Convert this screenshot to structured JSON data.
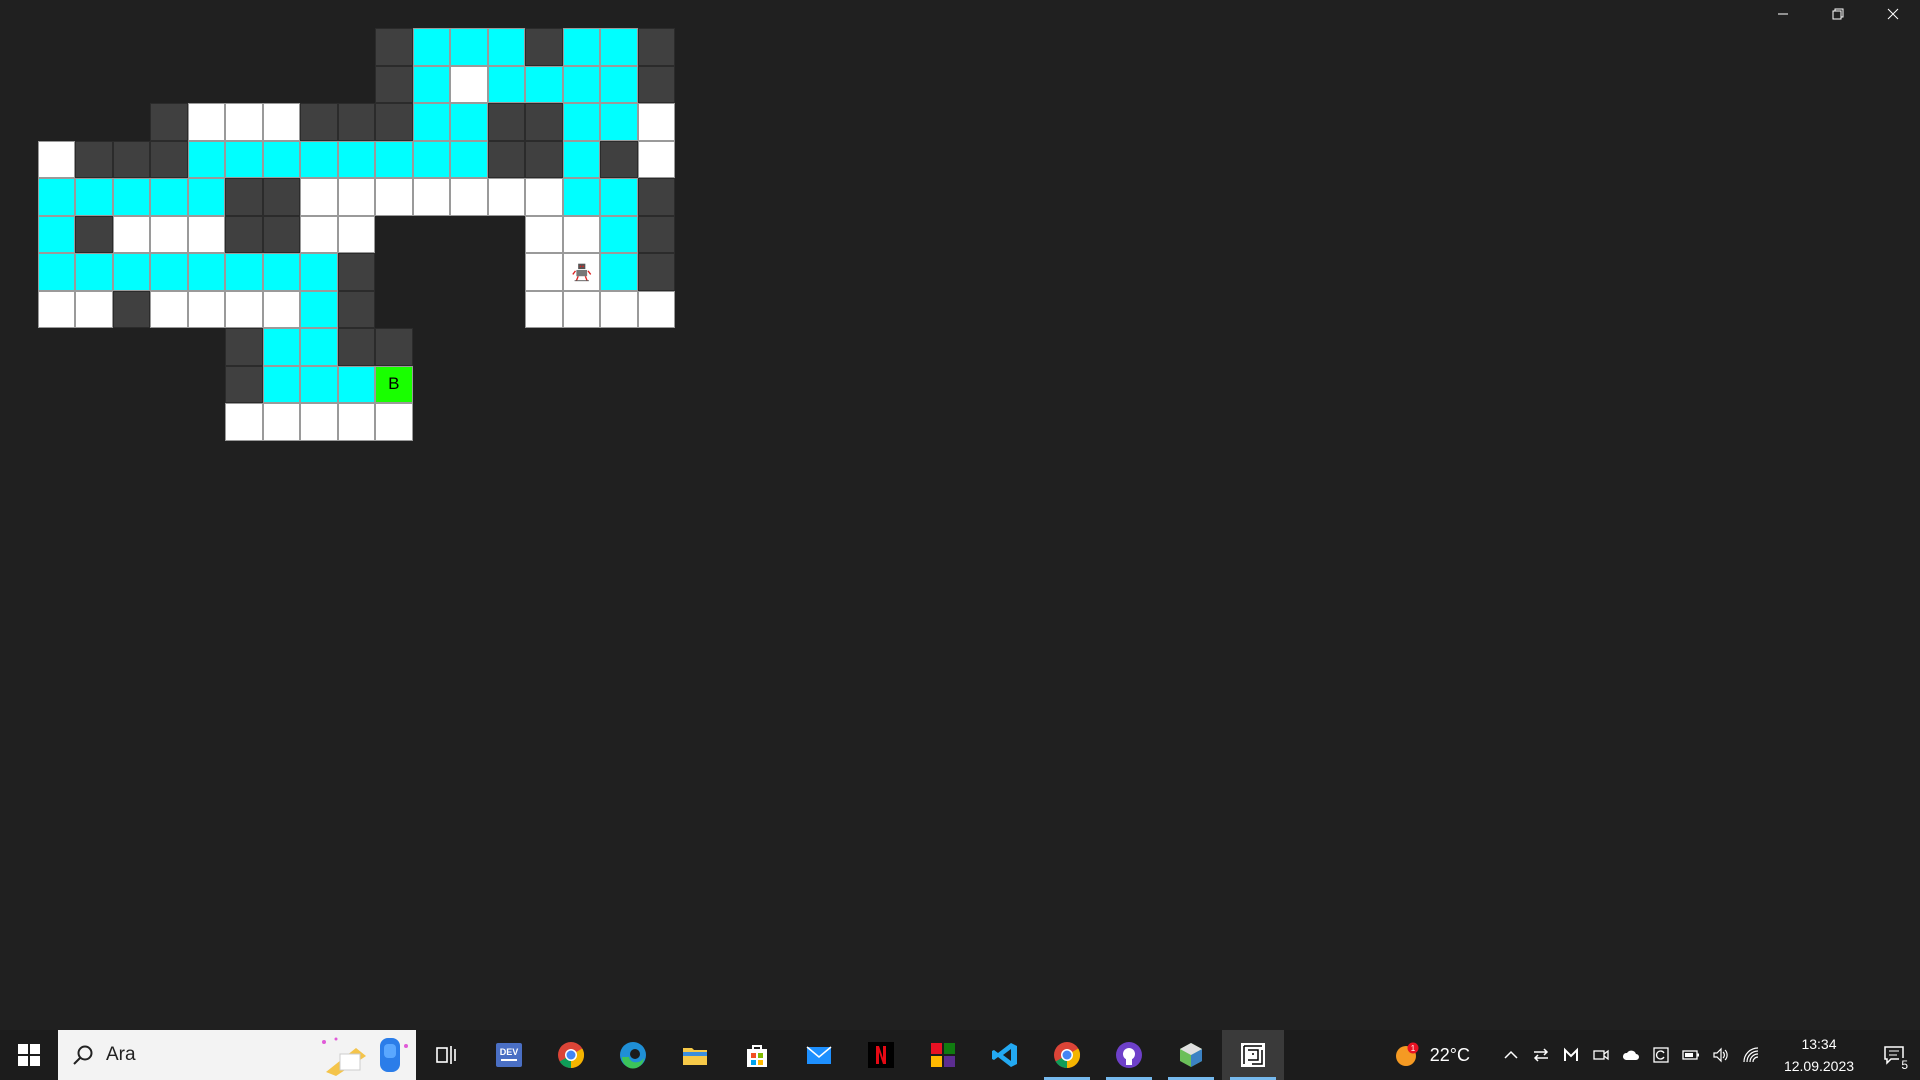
{
  "window": {
    "controls": [
      "minimize",
      "restore",
      "close"
    ]
  },
  "maze": {
    "rows": [
      "..........DCCCDCCD",
      "..........DCWCCCCD",
      "....DWWWDDDCCDDCCW",
      ".WDDDCCCCCCCCDDCDW",
      ".CCCCCDDWWWWWWWCCD",
      ".CDWWWDDWW....WWCD",
      ".CCCCCCCCD....WRCD",
      ".WWDWWWWCD....WWWW",
      "......DCCDD.......",
      "......DCCCG.......",
      "......WWWWW......."
    ],
    "legend": {
      "W": "open",
      "D": "wall",
      "C": "visited",
      "G": "goal",
      "R": "robot"
    },
    "goal_label": "B",
    "colors": {
      "open": "#ffffff",
      "wall": "#404040",
      "visited": "#00ffff",
      "goal": "#19ff00"
    }
  },
  "taskbar": {
    "search_placeholder": "Ara",
    "apps": [
      {
        "name": "task-view",
        "open": false
      },
      {
        "name": "devtoys",
        "open": false
      },
      {
        "name": "chrome",
        "open": false
      },
      {
        "name": "edge",
        "open": false
      },
      {
        "name": "file-explorer",
        "open": false
      },
      {
        "name": "microsoft-store",
        "open": false
      },
      {
        "name": "mail",
        "open": false
      },
      {
        "name": "netflix",
        "open": false
      },
      {
        "name": "colorful-app",
        "open": false
      },
      {
        "name": "vscode",
        "open": false
      },
      {
        "name": "chrome-2",
        "open": true
      },
      {
        "name": "github-desktop",
        "open": true
      },
      {
        "name": "box-app",
        "open": true
      },
      {
        "name": "maze-app",
        "open": true,
        "active": true
      }
    ],
    "dev_badge": "DEV",
    "weather": {
      "temperature": "22°C",
      "badge": "1"
    },
    "clock": {
      "time": "13:34",
      "date": "12.09.2023"
    },
    "notifications": {
      "count": "5"
    }
  }
}
